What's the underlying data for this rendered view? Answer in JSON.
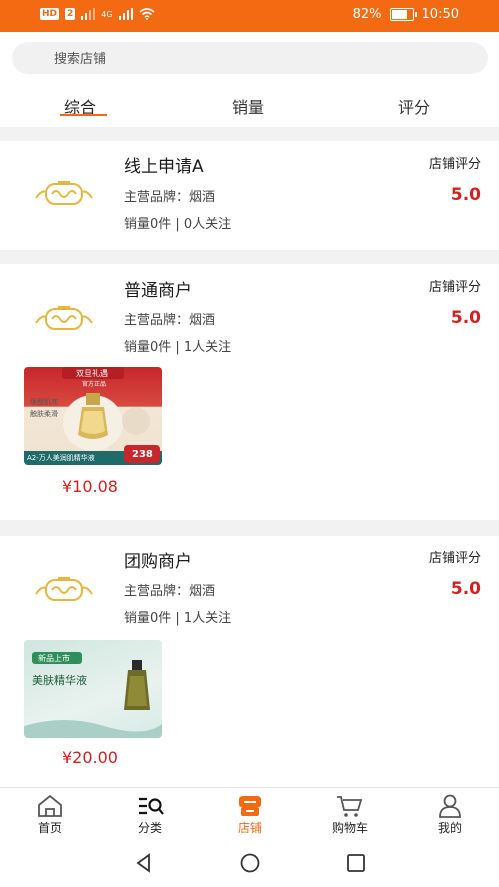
{
  "status": {
    "hd": "HD",
    "sim": "2",
    "network": "4G",
    "battery": "82%",
    "time": "10:50"
  },
  "search": {
    "placeholder": "搜索店铺"
  },
  "tabs": [
    {
      "label": "综合"
    },
    {
      "label": "销量"
    },
    {
      "label": "评分"
    }
  ],
  "shops": [
    {
      "name": "线上申请A",
      "brand": "主营品牌：烟酒",
      "stats": "销量0件 | 0人关注",
      "rating_label": "店铺评分",
      "rating": "5.0",
      "products": []
    },
    {
      "name": "普通商户",
      "brand": "主营品牌：烟酒",
      "stats": "销量0件 | 1人关注",
      "rating_label": "店铺评分",
      "rating": "5.0",
      "products": [
        {
          "price": "¥10.08",
          "banner": "双旦礼遇",
          "sub": "官方正品",
          "desc1": "焕醒肌底",
          "desc2": "触肤柔滑",
          "caption": "A2-万人美润肌精华液",
          "badge": "238"
        }
      ]
    },
    {
      "name": "团购商户",
      "brand": "主营品牌：烟酒",
      "stats": "销量0件 | 1人关注",
      "rating_label": "店铺评分",
      "rating": "5.0",
      "products": [
        {
          "price": "¥20.00",
          "banner": "新品上市",
          "desc1": "美肤精华液"
        }
      ]
    }
  ],
  "nav": [
    {
      "label": "首页"
    },
    {
      "label": "分类"
    },
    {
      "label": "店铺"
    },
    {
      "label": "购物车"
    },
    {
      "label": "我的"
    }
  ],
  "colors": {
    "accent": "#f36a12",
    "price": "#d61f1f"
  }
}
